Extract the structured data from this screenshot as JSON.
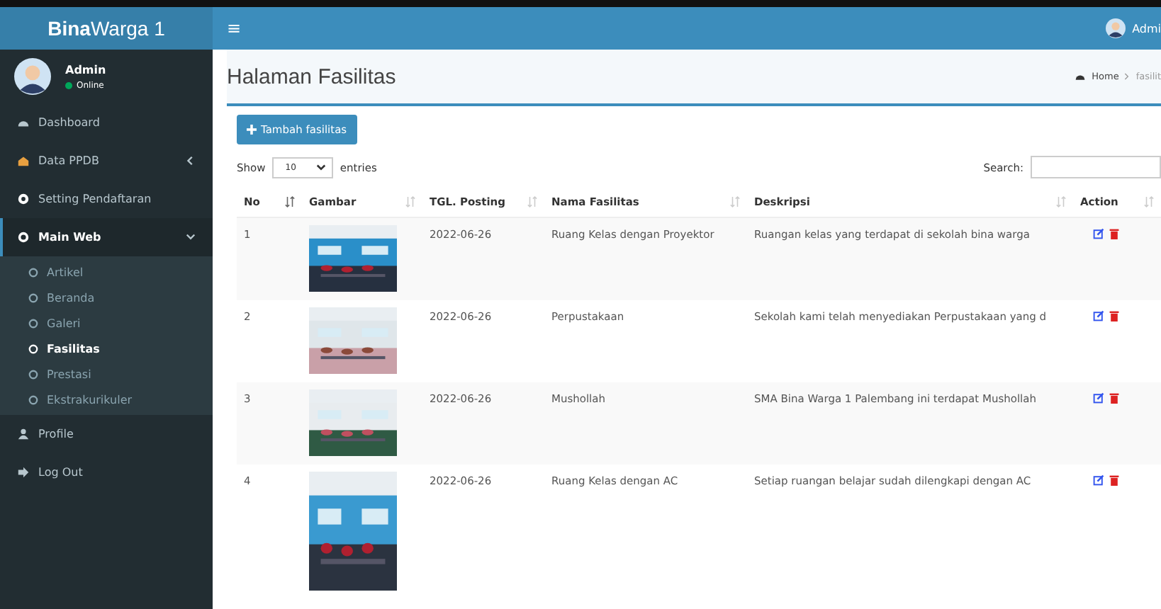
{
  "brand": {
    "bold": "Bina",
    "rest": "Warga 1"
  },
  "user": {
    "name": "Admin",
    "status": "Online"
  },
  "sidebar": {
    "items": [
      {
        "label": "Dashboard",
        "selected": false
      },
      {
        "label": "Data PPDB",
        "selected": false,
        "expanded": false
      },
      {
        "label": "Setting Pendaftaran",
        "selected": false
      },
      {
        "label": "Main Web",
        "selected": true,
        "expanded": true,
        "children": [
          {
            "label": "Artikel",
            "selected": false
          },
          {
            "label": "Beranda",
            "selected": false
          },
          {
            "label": "Galeri",
            "selected": false
          },
          {
            "label": "Fasilitas",
            "selected": true
          },
          {
            "label": "Prestasi",
            "selected": false
          },
          {
            "label": "Ekstrakurikuler",
            "selected": false
          }
        ]
      },
      {
        "label": "Profile",
        "selected": false
      },
      {
        "label": "Log Out",
        "selected": false
      }
    ]
  },
  "header": {
    "menu_glyph": "≡",
    "user": "Admi"
  },
  "page": {
    "title": "Halaman Fasilitas",
    "breadcrumb": [
      "Home",
      "fasilit"
    ]
  },
  "add_button": "Tambah fasilitas",
  "length": {
    "before": "Show",
    "value": "10",
    "after": "entries"
  },
  "search": {
    "label": "Search:"
  },
  "table": {
    "columns": [
      "No",
      "Gambar",
      "TGL. Posting",
      "Nama Fasilitas",
      "Deskripsi",
      "Action"
    ],
    "rows": [
      {
        "no": "1",
        "date": "2022-06-26",
        "name": "Ruang Kelas dengan Proyektor",
        "description": "Ruangan kelas yang terdapat di sekolah bina warga"
      },
      {
        "no": "2",
        "date": "2022-06-26",
        "name": "Perpustakaan",
        "description": "Sekolah kami telah menyediakan Perpustakaan yang d"
      },
      {
        "no": "3",
        "date": "2022-06-26",
        "name": "Mushollah",
        "description": "SMA Bina Warga 1 Palembang ini terdapat Mushollah"
      },
      {
        "no": "4",
        "date": "2022-06-26",
        "name": "Ruang Kelas dengan AC",
        "description": "Setiap ruangan belajar sudah dilengkapi dengan AC"
      }
    ]
  }
}
